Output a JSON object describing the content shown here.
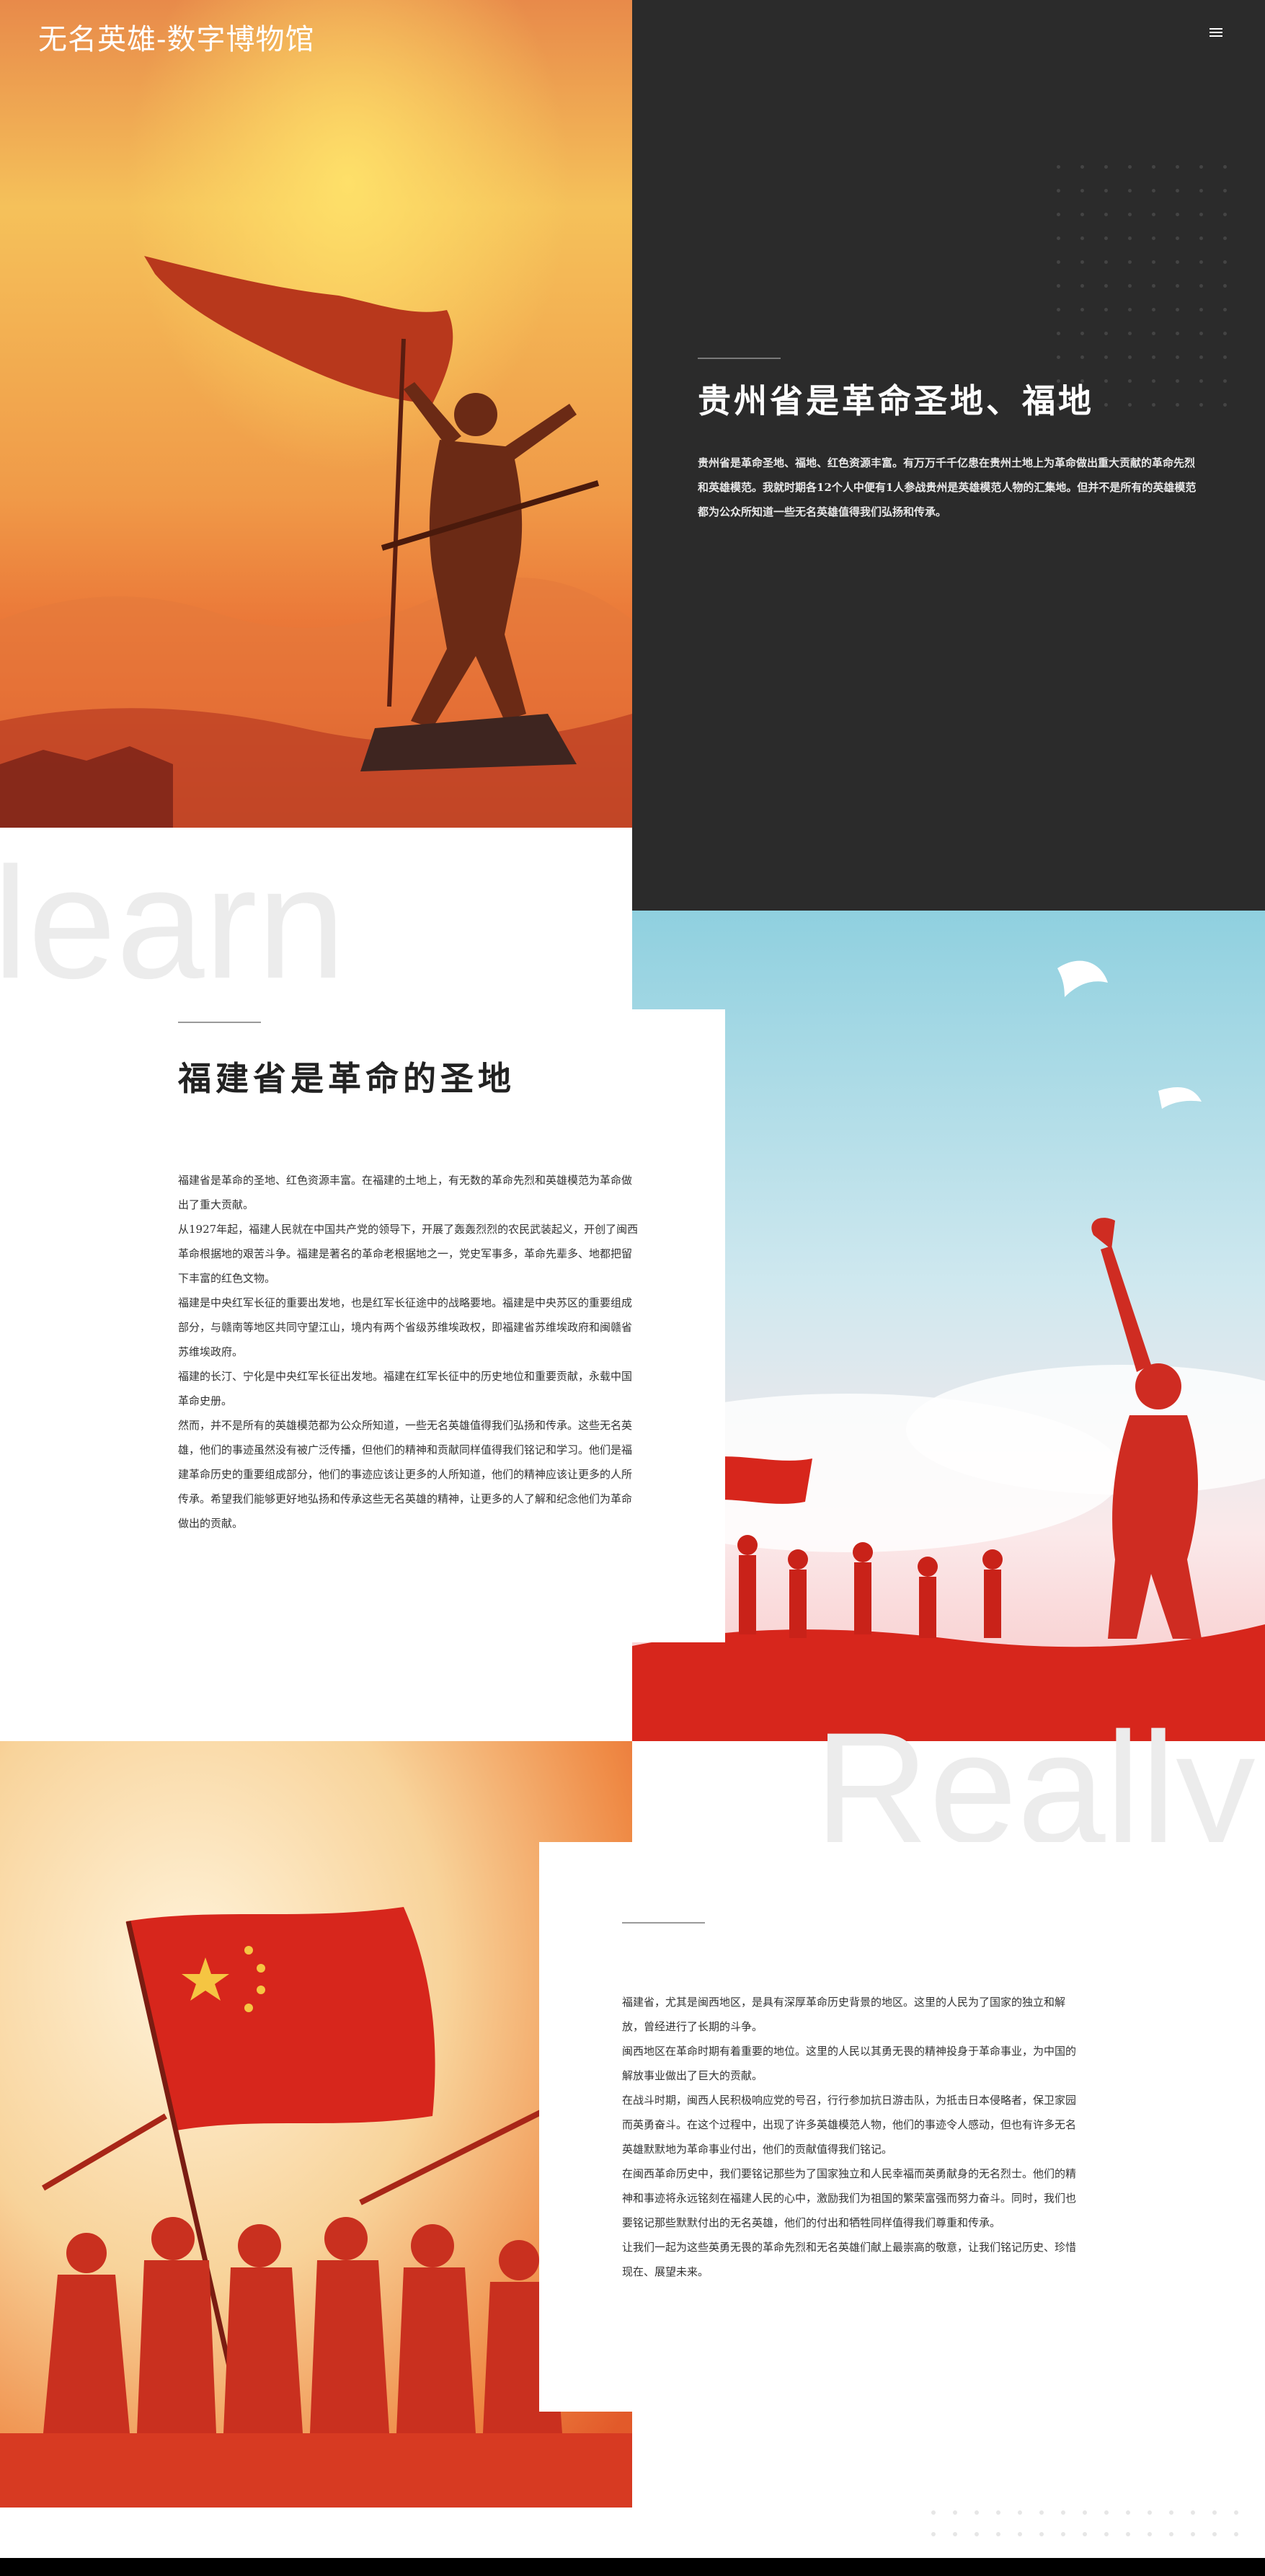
{
  "header": {
    "site_title": "无名英雄-数字博物馆",
    "menu_icon": "hamburger-menu-icon"
  },
  "section1": {
    "heading": "贵州省是革命圣地、福地",
    "paragraph": "贵州省是革命圣地、福地、红色资源丰富。有万万千千亿患在贵州土地上为革命做出重大贡献的革命先烈和英雄模范。我就时期各12个人中便有1人参战贵州是英雄模范人物的汇集地。但并不是所有的英雄模范都为公众所知道一些无名英雄值得我们弘扬和传承。"
  },
  "section2": {
    "watermark": "learn",
    "heading": "福建省是革命的圣地",
    "paragraphs": [
      "福建省是革命的圣地、红色资源丰富。在福建的土地上，有无数的革命先烈和英雄模范为革命做出了重大贡献。",
      "从1927年起，福建人民就在中国共产党的领导下，开展了轰轰烈烈的农民武装起义，开创了闽西革命根据地的艰苦斗争。福建是著名的革命老根据地之一，党史军事多，革命先辈多、地都把留下丰富的红色文物。",
      "福建是中央红军长征的重要出发地，也是红军长征途中的战略要地。福建是中央苏区的重要组成部分，与赣南等地区共同守望江山，境内有两个省级苏维埃政权，即福建省苏维埃政府和闽赣省苏维埃政府。",
      "福建的长汀、宁化是中央红军长征出发地。福建在红军长征中的历史地位和重要贡献，永载中国革命史册。",
      "然而，并不是所有的英雄模范都为公众所知道，一些无名英雄值得我们弘扬和传承。这些无名英雄，他们的事迹虽然没有被广泛传播，但他们的精神和贡献同样值得我们铭记和学习。他们是福建革命历史的重要组成部分，他们的事迹应该让更多的人所知道，他们的精神应该让更多的人所传承。希望我们能够更好地弘扬和传承这些无名英雄的精神，让更多的人了解和纪念他们为革命做出的贡献。"
    ]
  },
  "section3": {
    "watermark": "Really",
    "paragraphs": [
      "福建省，尤其是闽西地区，是具有深厚革命历史背景的地区。这里的人民为了国家的独立和解放，曾经进行了长期的斗争。",
      "闽西地区在革命时期有着重要的地位。这里的人民以其勇无畏的精神投身于革命事业，为中国的解放事业做出了巨大的贡献。",
      "在战斗时期，闽西人民积极响应党的号召，行行参加抗日游击队，为抵击日本侵略者，保卫家园而英勇奋斗。在这个过程中，出现了许多英雄模范人物，他们的事迹令人感动，但也有许多无名英雄默默地为革命事业付出，他们的贡献值得我们铭记。",
      "在闽西革命历史中，我们要铭记那些为了国家独立和人民幸福而英勇献身的无名烈士。他们的精神和事迹将永远铭刻在福建人民的心中，激励我们为祖国的繁荣富强而努力奋斗。同时，我们也要铭记那些默默付出的无名英雄，他们的付出和牺牲同样值得我们尊重和传承。",
      "让我们一起为这些英勇无畏的革命先烈和无名英雄们献上最崇高的敬意，让我们铭记历史、珍惜现在、展望未来。"
    ]
  },
  "colors": {
    "dark_panel": "#2b2b2b",
    "flag_red": "#d7261c",
    "gold": "#f5c542"
  }
}
